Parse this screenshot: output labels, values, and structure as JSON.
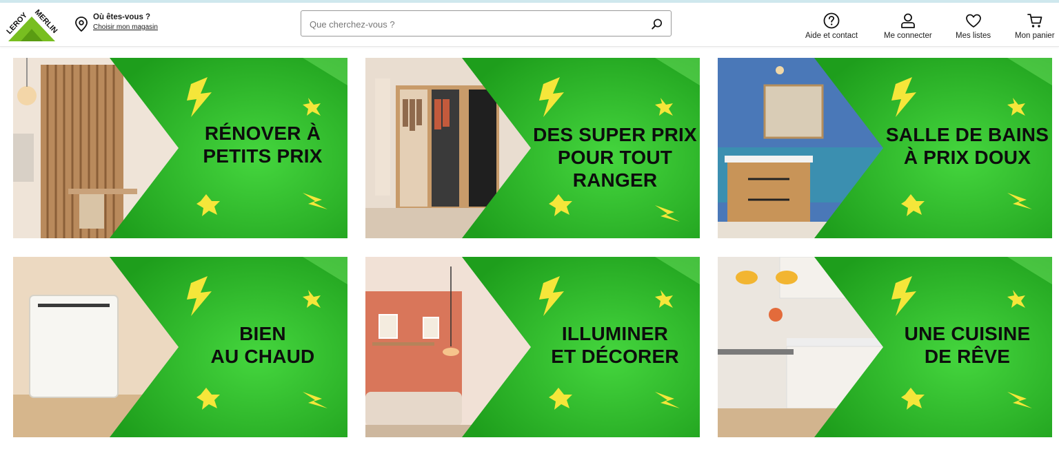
{
  "brand": {
    "name": "LEROY MERLIN",
    "logo_letters": "LEROY MERLIN",
    "color": "#78be20"
  },
  "store": {
    "question": "Où êtes-vous ?",
    "link": "Choisir mon magasin",
    "icon": "location-pin-icon"
  },
  "search": {
    "placeholder": "Que cherchez-vous ?",
    "value": "",
    "icon": "search-icon"
  },
  "nav": [
    {
      "label": "Aide et contact",
      "icon": "help-circle-icon"
    },
    {
      "label": "Me connecter",
      "icon": "user-icon"
    },
    {
      "label": "Mes listes",
      "icon": "heart-icon"
    },
    {
      "label": "Mon panier",
      "icon": "cart-icon"
    }
  ],
  "promo_cards": [
    {
      "lines": [
        "RÉNOVER À",
        "PETITS PRIX"
      ],
      "scene": "bedroom desk with wood slat wall"
    },
    {
      "lines": [
        "DES SUPER PRIX",
        "POUR TOUT",
        "RANGER"
      ],
      "scene": "open wardrobe storage"
    },
    {
      "lines": [
        "SALLE DE BAINS",
        "À PRIX DOUX"
      ],
      "scene": "blue bathroom with vanity"
    },
    {
      "lines": [
        "BIEN",
        "AU CHAUD"
      ],
      "scene": "white wall radiator"
    },
    {
      "lines": [
        "ILLUMINER",
        "ET DÉCORER"
      ],
      "scene": "living room with pendant lamp"
    },
    {
      "lines": [
        "UNE CUISINE",
        "DE RÊVE"
      ],
      "scene": "kitchen with yellow pendant lamps"
    }
  ],
  "colors": {
    "green": "#2fb82a",
    "green_light": "#3ed23a",
    "text": "#0d0d0d",
    "bolt": "#f5e63a"
  }
}
